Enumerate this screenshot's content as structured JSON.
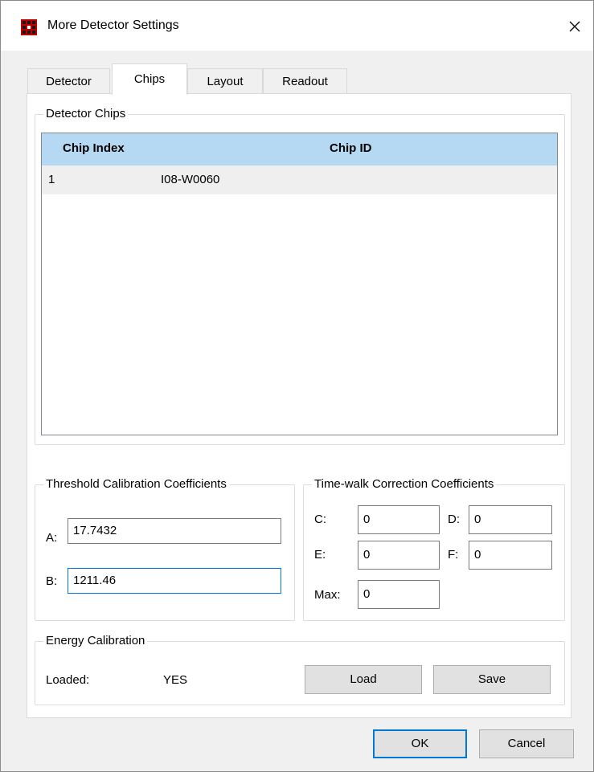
{
  "window": {
    "title": "More Detector Settings",
    "icon": "grid-app-icon",
    "close_glyph": "✕"
  },
  "tabs": [
    {
      "label": "Detector",
      "active": false
    },
    {
      "label": "Chips",
      "active": true
    },
    {
      "label": "Layout",
      "active": false
    },
    {
      "label": "Readout",
      "active": false
    }
  ],
  "detector_chips": {
    "title": "Detector Chips",
    "columns": [
      "Chip Index",
      "Chip ID"
    ],
    "rows": [
      {
        "index": "1",
        "id": "I08-W0060"
      }
    ]
  },
  "threshold": {
    "title": "Threshold Calibration Coefficients",
    "a_label": "A:",
    "a_value": "17.7432",
    "b_label": "B:",
    "b_value": "1211.46"
  },
  "timewalk": {
    "title": "Time-walk Correction Coefficients",
    "c_label": "C:",
    "c_value": "0",
    "d_label": "D:",
    "d_value": "0",
    "e_label": "E:",
    "e_value": "0",
    "f_label": "F:",
    "f_value": "0",
    "max_label": "Max:",
    "max_value": "0"
  },
  "energy": {
    "title": "Energy Calibration",
    "loaded_label": "Loaded:",
    "loaded_value": "YES",
    "load_label": "Load",
    "save_label": "Save"
  },
  "footer": {
    "ok_label": "OK",
    "cancel_label": "Cancel"
  },
  "colors": {
    "accent": "#0078d7",
    "header_bg": "#b6d9f3",
    "selected_row": "#efefef"
  }
}
